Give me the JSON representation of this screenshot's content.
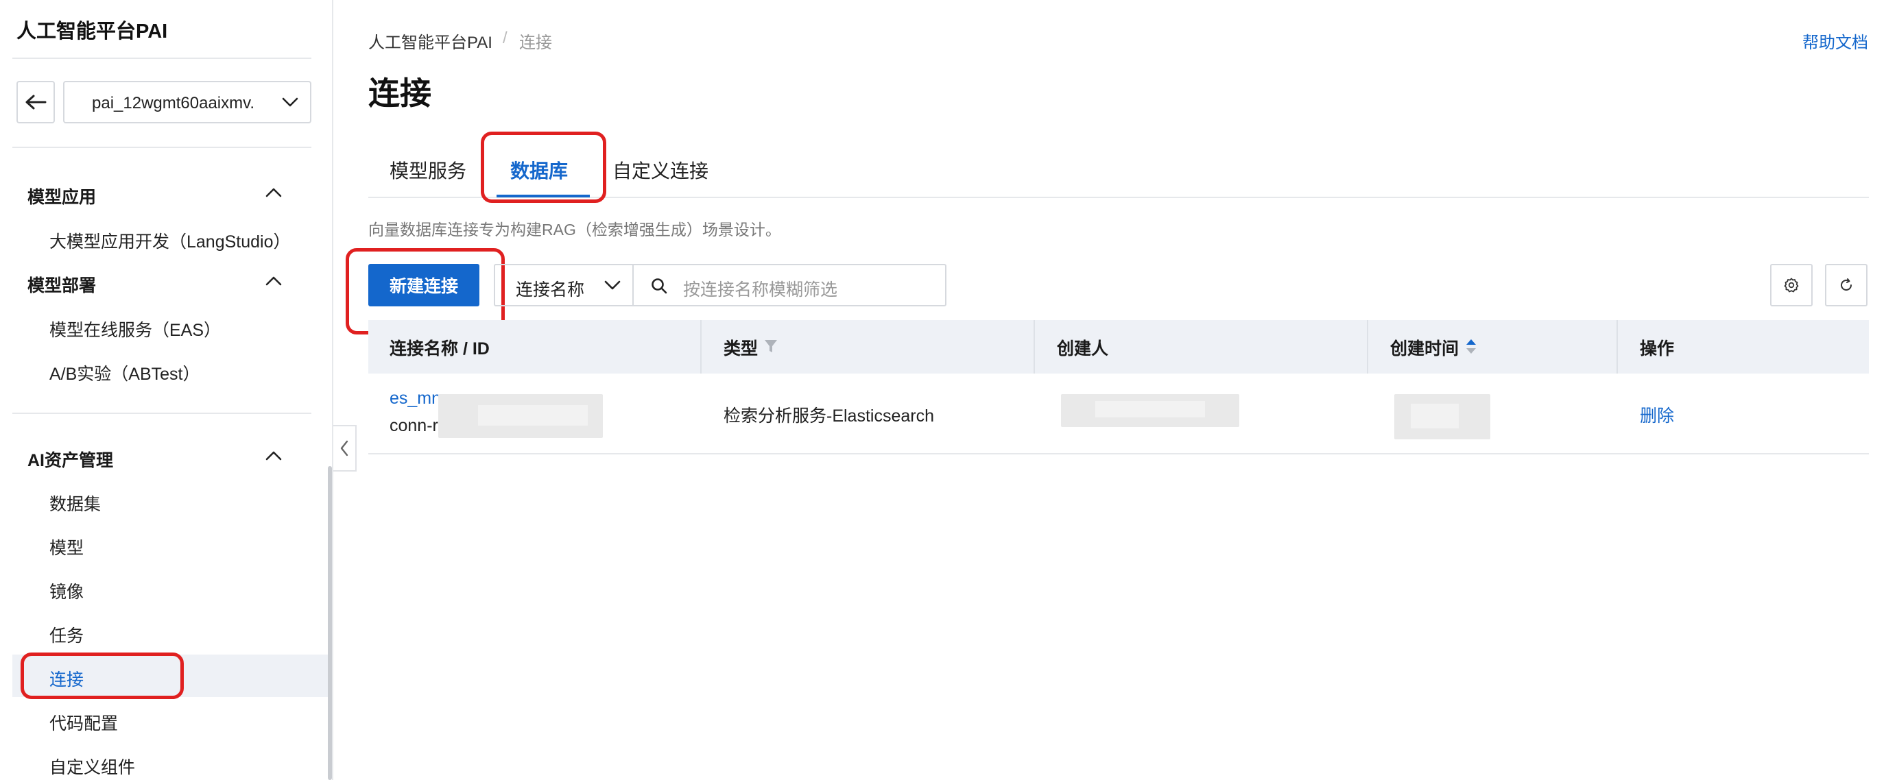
{
  "sidebar": {
    "app_title": "人工智能平台PAI",
    "workspace": "pai_12wgmt60aaixmv.",
    "groups": [
      {
        "label": "模型应用",
        "items": [
          "大模型应用开发（LangStudio）"
        ]
      },
      {
        "label": "模型部署",
        "items": [
          "模型在线服务（EAS）",
          "A/B实验（ABTest）"
        ]
      },
      {
        "label": "AI资产管理",
        "items": [
          "数据集",
          "模型",
          "镜像",
          "任务",
          "连接",
          "代码配置",
          "自定义组件"
        ]
      }
    ],
    "active_item": "连接"
  },
  "breadcrumb": {
    "root": "人工智能平台PAI",
    "sep": "/",
    "current": "连接"
  },
  "help_link": "帮助文档",
  "page_title": "连接",
  "tabs": [
    {
      "label": "模型服务",
      "active": false
    },
    {
      "label": "数据库",
      "active": true
    },
    {
      "label": "自定义连接",
      "active": false
    }
  ],
  "description": "向量数据库连接专为构建RAG（检索增强生成）场景设计。",
  "toolbar": {
    "new_button": "新建连接",
    "filter_field": "连接名称",
    "search_placeholder": "按连接名称模糊筛选",
    "settings_icon": "gear-icon",
    "refresh_icon": "refresh-icon"
  },
  "table": {
    "columns": [
      "连接名称 / ID",
      "类型",
      "创建人",
      "创建时间",
      "操作"
    ],
    "rows": [
      {
        "name": "es_mn",
        "id": "conn-r",
        "type": "检索分析服务-Elasticsearch",
        "action": "删除"
      }
    ]
  },
  "colors": {
    "accent": "#1467cc",
    "highlight": "#e02020",
    "header_bg": "#eef1f6"
  }
}
